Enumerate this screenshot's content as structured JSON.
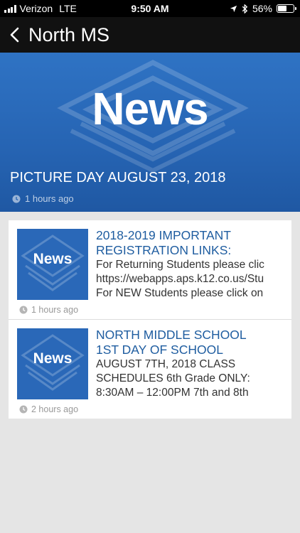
{
  "status_bar": {
    "carrier": "Verizon",
    "network": "LTE",
    "time": "9:50 AM",
    "battery_percent": "56%",
    "battery_level": 0.56
  },
  "nav": {
    "title": "North MS"
  },
  "hero": {
    "image_word": "News",
    "title": "PICTURE DAY AUGUST 23, 2018",
    "time": "1 hours ago"
  },
  "news_items": [
    {
      "image_word": "News",
      "title_line1": "2018-2019 IMPORTANT",
      "title_line2": "REGISTRATION LINKS:",
      "body_line1": "For Returning Students please clic",
      "body_line2": "https://webapps.aps.k12.co.us/Stu",
      "body_line3": "For NEW Students please click on",
      "time": "1 hours ago"
    },
    {
      "image_word": "News",
      "title_line1": "NORTH MIDDLE SCHOOL",
      "title_line2": "1ST DAY OF SCHOOL",
      "body_line1": "AUGUST 7TH, 2018 CLASS",
      "body_line2": "SCHEDULES 6th Grade ONLY:",
      "body_line3": "8:30AM – 12:00PM 7th and 8th",
      "time": "2 hours ago"
    }
  ]
}
